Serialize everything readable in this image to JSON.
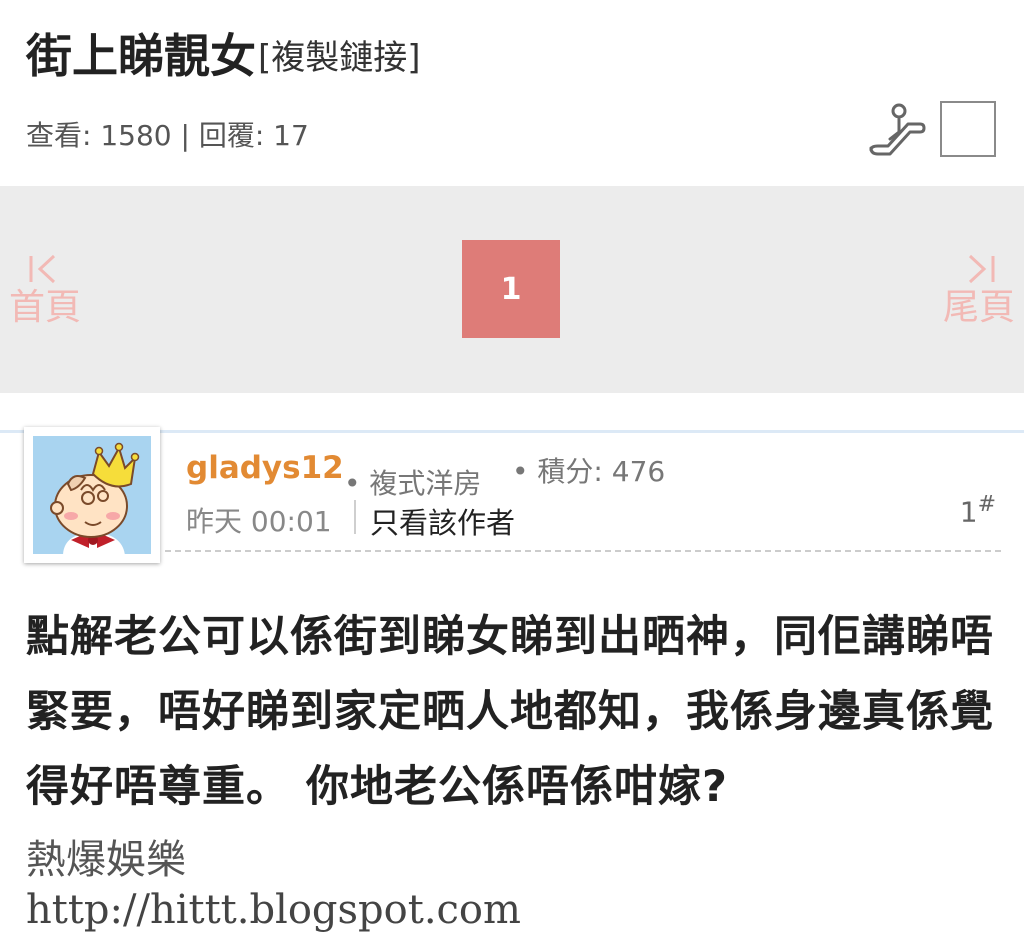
{
  "header": {
    "title": "街上睇靚女",
    "copy_link": "[複製鏈接]",
    "stats": "查看: 1580 | 回覆: 17"
  },
  "pagination": {
    "first_label": "首頁",
    "last_label": "尾頁",
    "current_page": "1",
    "accent_color": "#de7c78"
  },
  "post": {
    "username": "gladys12",
    "user_level": "• 複式洋房",
    "points": "• 積分: 476",
    "time": "昨天 00:01",
    "author_only": "只看該作者",
    "floor": "1",
    "floor_suffix": "#",
    "body": "點解老公可以係街到睇女睇到出晒神，同佢講睇唔緊要，唔好睇到家定晒人地都知，我係身邊真係覺得好唔尊重。 你地老公係唔係咁嫁?"
  },
  "watermark": {
    "line1": "熱爆娛樂",
    "line2": "http://hittt.blogspot.com"
  },
  "icons": {
    "escalator": "escalator-icon",
    "first_page": "first-page-icon",
    "last_page": "last-page-icon",
    "avatar": "avatar"
  }
}
